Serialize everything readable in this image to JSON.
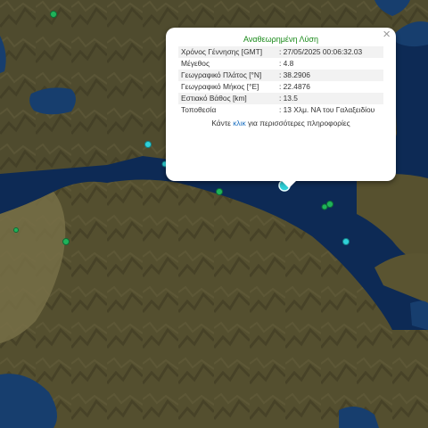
{
  "popup": {
    "title": "Αναθεωρημένη Λύση",
    "close_symbol": "×",
    "rows": [
      {
        "label": "Χρόνος Γέννησης [GMT]",
        "value": ": 27/05/2025 00:06:32.03"
      },
      {
        "label": "Μέγεθος",
        "value": ": 4.8"
      },
      {
        "label": "Γεωγραφικό Πλάτος [°N]",
        "value": ": 38.2906"
      },
      {
        "label": "Γεωγραφικό Μήκος [°E]",
        "value": ": 22.4876"
      },
      {
        "label": "Εστιακό Βάθος [km]",
        "value": ": 13.5"
      },
      {
        "label": "Τοποθεσία",
        "value": ": 13 Χλμ. ΝΑ του Γαλαξειδίου"
      }
    ],
    "more_prefix": "Κάντε",
    "more_link": "κλικ",
    "more_suffix": "για περισσότερες πληροφορίες"
  },
  "colors": {
    "sea": "#0d2a55",
    "land": "#4f4a2a",
    "quake_green": "#1fb35a",
    "quake_cyan": "#2fd0d8",
    "title_green": "#1a8a1a",
    "link_blue": "#1a6fc0"
  }
}
